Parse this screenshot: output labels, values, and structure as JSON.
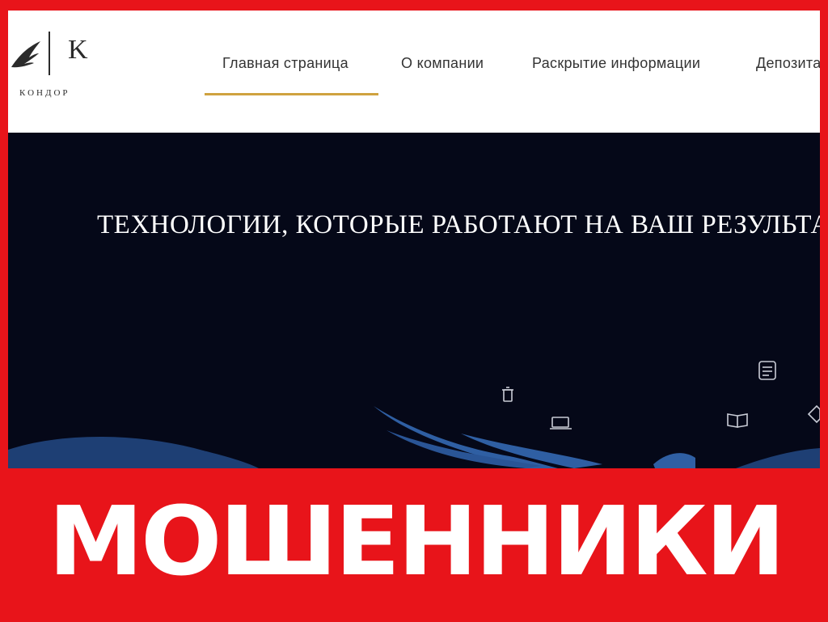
{
  "logo": {
    "letter": "K",
    "wordmark": "КОНДОР"
  },
  "nav": {
    "items": [
      {
        "label": "Главная страница",
        "active": true
      },
      {
        "label": "О компании"
      },
      {
        "label": "Раскрытие информации"
      },
      {
        "label": "Депозитарий"
      }
    ]
  },
  "hero": {
    "title": "ТЕХНОЛОГИИ, КОТОРЫЕ РАБОТАЮТ НА ВАШ РЕЗУЛЬТАТ"
  },
  "banner": {
    "text": "МОШЕННИКИ"
  },
  "colors": {
    "banner_red": "#e8141a",
    "hero_bg": "#050818",
    "nav_accent": "#cfa23f",
    "wing_blue": "#2f5fa3"
  },
  "icons": [
    "trash-icon",
    "laptop-icon",
    "document-icon",
    "book-icon",
    "diamond-icon"
  ]
}
